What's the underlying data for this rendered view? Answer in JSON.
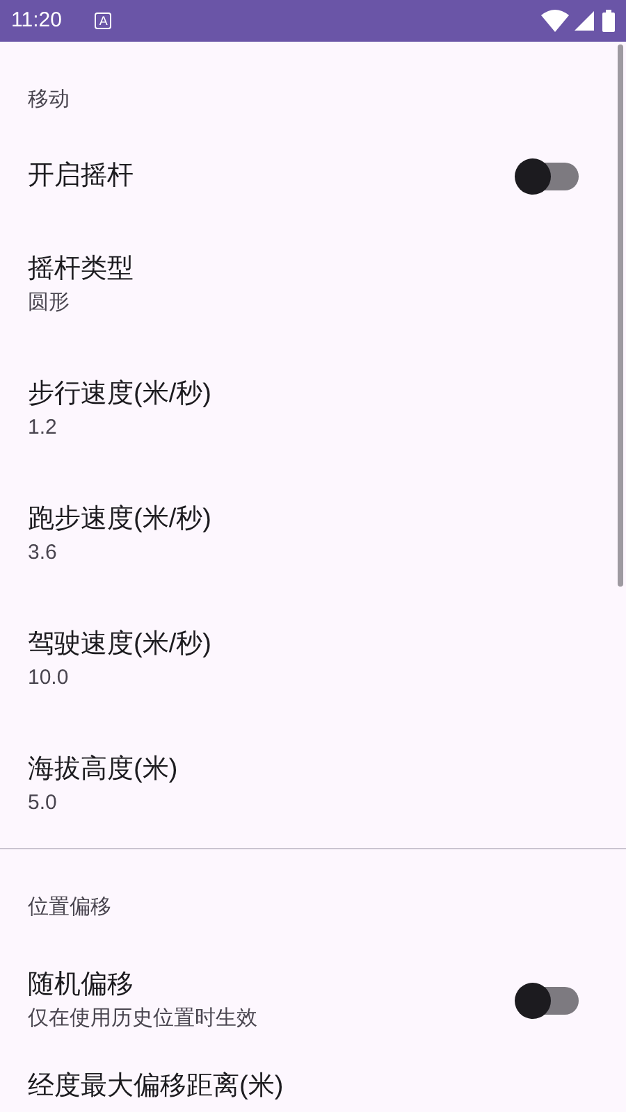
{
  "status_bar": {
    "time": "11:20",
    "notification": "A"
  },
  "sections": [
    {
      "title": "移动",
      "items": [
        {
          "kind": "switch",
          "title": "开启摇杆",
          "on": false
        },
        {
          "kind": "value",
          "title": "摇杆类型",
          "summary": "圆形"
        },
        {
          "kind": "value",
          "title": "步行速度(米/秒)",
          "summary": "1.2"
        },
        {
          "kind": "value",
          "title": "跑步速度(米/秒)",
          "summary": "3.6"
        },
        {
          "kind": "value",
          "title": "驾驶速度(米/秒)",
          "summary": "10.0"
        },
        {
          "kind": "value",
          "title": "海拔高度(米)",
          "summary": "5.0"
        }
      ]
    },
    {
      "title": "位置偏移",
      "items": [
        {
          "kind": "switch",
          "title": "随机偏移",
          "summary": "仅在使用历史位置时生效",
          "on": false
        },
        {
          "kind": "value",
          "title": "经度最大偏移距离(米)"
        }
      ]
    }
  ]
}
